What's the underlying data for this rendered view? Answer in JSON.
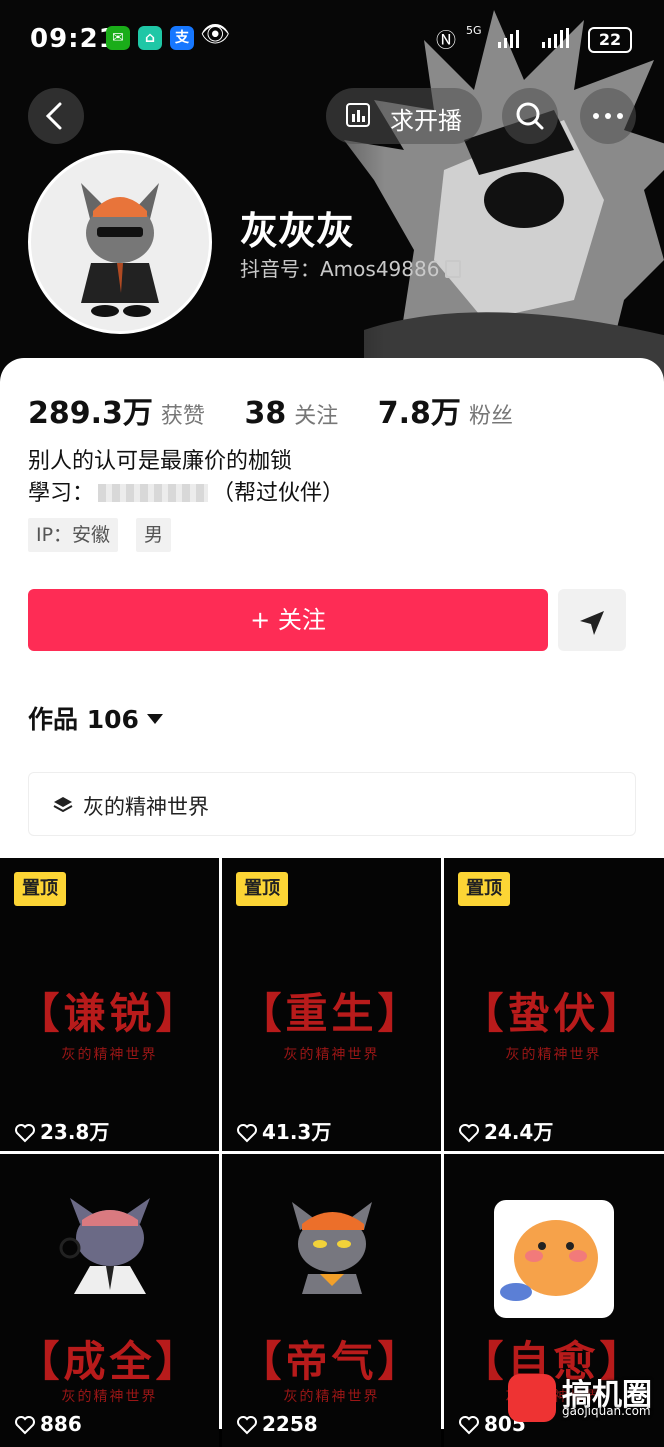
{
  "status_bar": {
    "time": "09:21",
    "battery": "22",
    "signal_text": "5G"
  },
  "header": {
    "request_live_label": "求开播"
  },
  "profile": {
    "name": "灰灰灰",
    "uid_label": "抖音号：",
    "uid": "Amos49886",
    "stats": [
      {
        "value": "289.3万",
        "label": "获赞"
      },
      {
        "value": "38",
        "label": "关注"
      },
      {
        "value": "7.8万",
        "label": "粉丝"
      }
    ],
    "bio_line1": "别人的认可是最廉价的枷锁",
    "bio_line2_prefix": "學习：",
    "bio_line2_suffix": "（帮过伙伴）",
    "tags": [
      "IP：安徽",
      "男"
    ]
  },
  "actions": {
    "follow_label": "+ 关注"
  },
  "works": {
    "label": "作品 106",
    "collection_label": "灰的精神世界"
  },
  "videos": [
    {
      "pinned": "置顶",
      "title": "【谦锐】",
      "subtitle": "灰的精神世界",
      "likes": "23.8万"
    },
    {
      "pinned": "置顶",
      "title": "【重生】",
      "subtitle": "灰的精神世界",
      "likes": "41.3万"
    },
    {
      "pinned": "置顶",
      "title": "【蛰伏】",
      "subtitle": "灰的精神世界",
      "likes": "24.4万"
    },
    {
      "title": "【成全】",
      "subtitle": "灰的精神世界",
      "likes": "886"
    },
    {
      "title": "【帝气】",
      "subtitle": "灰的精神世界",
      "likes": "2258"
    },
    {
      "title": "【自愈】",
      "subtitle": "灰的精神世界",
      "likes": "805"
    }
  ],
  "watermark": {
    "text": "搞机圈",
    "url": "gaojiquan.com"
  },
  "colors": {
    "follow": "#fe2c55",
    "pin": "#fcd535",
    "title_red": "#b81b1b"
  }
}
